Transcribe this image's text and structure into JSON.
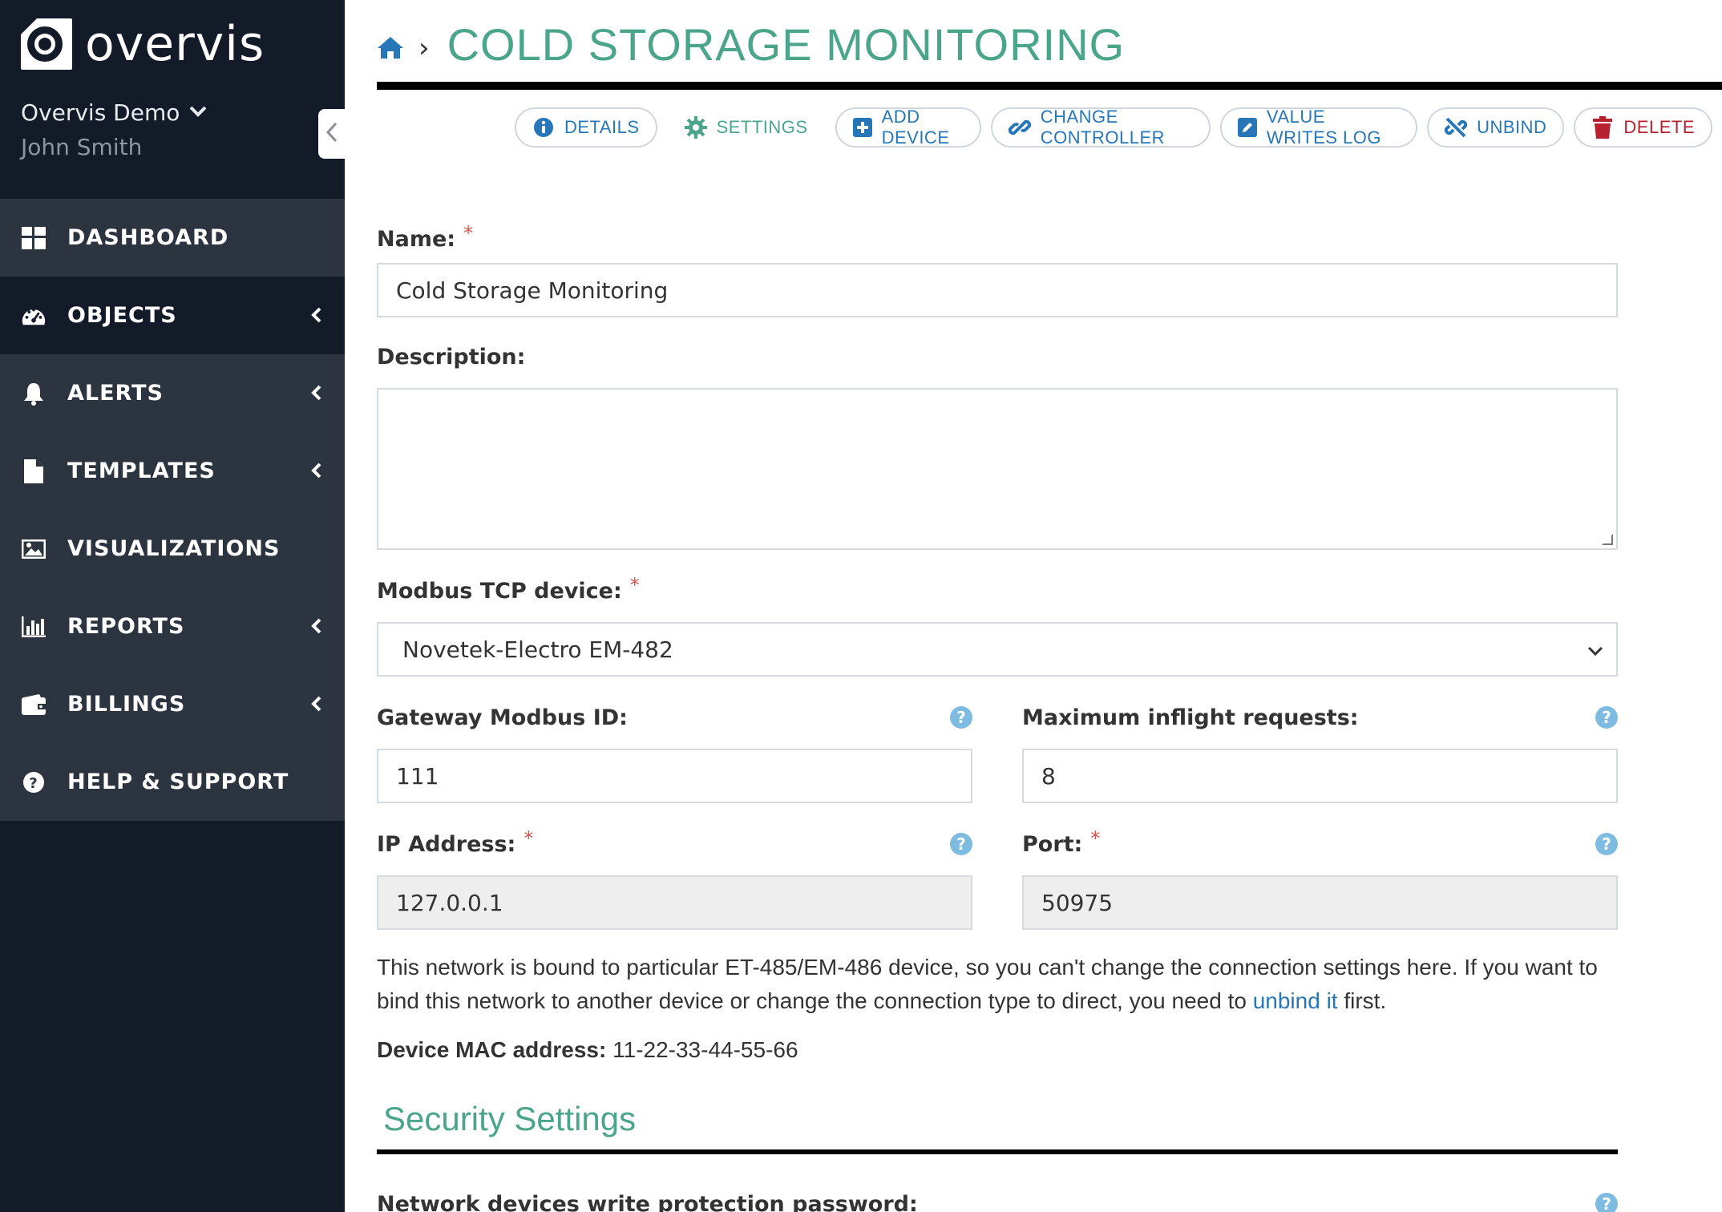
{
  "brand": {
    "name": "overvis"
  },
  "account": {
    "org": "Overvis Demo",
    "user": "John Smith"
  },
  "nav": [
    {
      "label": "DASHBOARD",
      "icon": "dashboard-icon",
      "has_arrow": false
    },
    {
      "label": "OBJECTS",
      "icon": "gauge-icon",
      "has_arrow": true,
      "active": true
    },
    {
      "label": "ALERTS",
      "icon": "bell-icon",
      "has_arrow": true
    },
    {
      "label": "TEMPLATES",
      "icon": "file-icon",
      "has_arrow": true
    },
    {
      "label": "VISUALIZATIONS",
      "icon": "image-icon",
      "has_arrow": false
    },
    {
      "label": "REPORTS",
      "icon": "bar-chart-icon",
      "has_arrow": true
    },
    {
      "label": "BILLINGS",
      "icon": "wallet-icon",
      "has_arrow": true
    },
    {
      "label": "HELP & SUPPORT",
      "icon": "question-circle-icon",
      "has_arrow": false
    }
  ],
  "header": {
    "title": "COLD STORAGE MONITORING",
    "separator": "›"
  },
  "toolbar": {
    "details": "DETAILS",
    "settings": "SETTINGS",
    "add_device": "ADD DEVICE",
    "change_controller": "CHANGE CONTROLLER",
    "value_writes_log": "VALUE WRITES LOG",
    "unbind": "UNBIND",
    "delete": "DELETE"
  },
  "form": {
    "name_label": "Name:",
    "name_value": "Cold Storage Monitoring",
    "description_label": "Description:",
    "description_value": "",
    "device_label": "Modbus TCP device:",
    "device_value": "Novetek-Electro EM-482",
    "gateway_label": "Gateway Modbus ID:",
    "gateway_value": "111",
    "inflight_label": "Maximum inflight requests:",
    "inflight_value": "8",
    "ip_label": "IP Address:",
    "ip_value": "127.0.0.1",
    "port_label": "Port:",
    "port_value": "50975",
    "required_mark": "*",
    "help_mark": "?"
  },
  "note": {
    "text_before": "This network is bound to particular ET-485/EM-486 device, so you can't change the connection settings here. If you want to bind this network to another device or change the connection type to direct, you need to ",
    "link": "unbind it",
    "text_after": " first."
  },
  "mac": {
    "label": "Device MAC address:",
    "value": "11-22-33-44-55-66"
  },
  "security": {
    "title": "Security Settings",
    "password_label": "Network devices write protection password:"
  },
  "colors": {
    "accent": "#4aa58a",
    "link": "#2777b8",
    "danger": "#b8202f",
    "sidebar": "#131b28",
    "nav_bg": "#2c3440"
  }
}
